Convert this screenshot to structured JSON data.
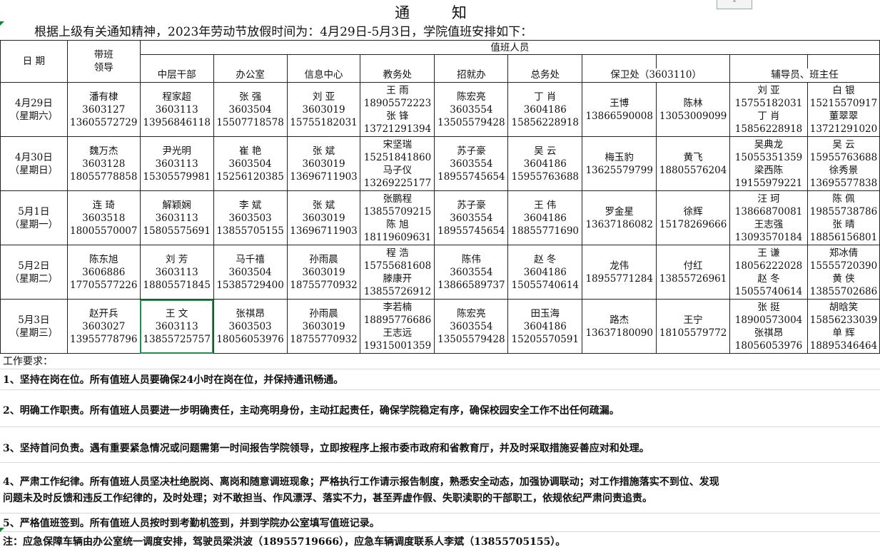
{
  "notice": {
    "title": "通 知",
    "intro": "根据上级有关通知精神，2023年劳动节放假时间为：4月29日-5月3日，学院值班安排如下：",
    "collapse_label": "⌃"
  },
  "table": {
    "headers": {
      "date": "日 期",
      "leader": [
        "带班",
        "领导"
      ],
      "duty_group": "值班人员",
      "cols": [
        "中层干部",
        "办公室",
        "信息中心",
        "教务处",
        "招就办",
        "总务处",
        "保卫处（3603110）",
        "辅导员、班主任"
      ]
    },
    "rows": [
      {
        "date": [
          "4月29日",
          "（星期六）"
        ],
        "cells": [
          [
            "潘有棣",
            "3603127",
            "13605572729"
          ],
          [
            "程家超",
            "3603113",
            "13956846118"
          ],
          [
            "张 强",
            "3603504",
            "15507718578"
          ],
          [
            "刘 亚",
            "3603019",
            "15755182031"
          ],
          [
            "王 雨",
            "18905572223",
            "张 锋",
            "13721291394"
          ],
          [
            "陈宏亮",
            "3603554",
            "13505579428"
          ],
          [
            "丁 肖",
            "3604186",
            "15856228918"
          ],
          [
            "王博",
            "13866590008"
          ],
          [
            "陈林",
            "13053009099"
          ],
          [
            "刘 亚",
            "15755182031",
            "丁 肖",
            "15856228918"
          ],
          [
            "白 银",
            "15215570917",
            "董翠翠",
            "13721291020"
          ]
        ]
      },
      {
        "date": [
          "4月30日",
          "（星期日）"
        ],
        "cells": [
          [
            "魏万杰",
            "3603128",
            "18055778858"
          ],
          [
            "尹光明",
            "3603113",
            "15305579981"
          ],
          [
            "崔 艳",
            "3603504",
            "15256120385"
          ],
          [
            "张 斌",
            "3603019",
            "13696711903"
          ],
          [
            "宋坚瑞",
            "15251841860",
            "马子仪",
            "13269225177"
          ],
          [
            "苏子豪",
            "3603554",
            "18955745654"
          ],
          [
            "吴 云",
            "3604186",
            "15955763688"
          ],
          [
            "梅玉豹",
            "13625579799"
          ],
          [
            "黄飞",
            "18805576204"
          ],
          [
            "吴典龙",
            "15055351359",
            "梁西陈",
            "19155979221"
          ],
          [
            "吴 云",
            "15955763688",
            "徐秀景",
            "13695577838"
          ]
        ]
      },
      {
        "date": [
          "5月1日",
          "（星期一）"
        ],
        "cells": [
          [
            "连 琦",
            "3603518",
            "18005570007"
          ],
          [
            "解颖娴",
            "3603113",
            "15805575691"
          ],
          [
            "李 斌",
            "3603503",
            "13855705155"
          ],
          [
            "张 斌",
            "3603019",
            "13696711903"
          ],
          [
            "张鹏程",
            "13855709215",
            "陈 旭",
            "18119609631"
          ],
          [
            "苏子豪",
            "3603554",
            "18955745654"
          ],
          [
            "王 伟",
            "3604186",
            "18855771690"
          ],
          [
            "罗金星",
            "13637186082"
          ],
          [
            "徐辉",
            "15178269666"
          ],
          [
            "汪 珂",
            "13866870081",
            "王志强",
            "13093570184"
          ],
          [
            "陈 佩",
            "19855738786",
            "张 晴",
            "18856156801"
          ]
        ]
      },
      {
        "date": [
          "5月2日",
          "（星期二）"
        ],
        "cells": [
          [
            "陈东旭",
            "3606886",
            "17705577226"
          ],
          [
            "刘 芳",
            "3603113",
            "18805571845"
          ],
          [
            "马千禧",
            "3603504",
            "15385729400"
          ],
          [
            "孙雨晨",
            "3603019",
            "18755770932"
          ],
          [
            "程 浩",
            "15755681608",
            "滕康开",
            "13855726912"
          ],
          [
            "陈伟",
            "3603554",
            "13866589737"
          ],
          [
            "赵 冬",
            "3604186",
            "15055740614"
          ],
          [
            "龙伟",
            "18955771284"
          ],
          [
            "付红",
            "13855726961"
          ],
          [
            "王 谦",
            "18056222028",
            "赵 冬",
            "15055740614"
          ],
          [
            "郑冰倩",
            "15555720390",
            "黄 侠",
            "13855702686"
          ]
        ]
      },
      {
        "date": [
          "5月3日",
          "（星期三）"
        ],
        "cells": [
          [
            "赵开兵",
            "3603027",
            "13955778796"
          ],
          [
            "王 文",
            "3603113",
            "13855725757"
          ],
          [
            "张祺昂",
            "3603503",
            "18056053976"
          ],
          [
            "孙雨晨",
            "3603019",
            "18755770932"
          ],
          [
            "李若楠",
            "18895776686",
            "王志远",
            "19315001359"
          ],
          [
            "陈宏亮",
            "3603554",
            "13505579428"
          ],
          [
            "田玉海",
            "3604186",
            "15205570591"
          ],
          [
            "路杰",
            "13637180090"
          ],
          [
            "王宁",
            "18105579772"
          ],
          [
            "张 挺",
            "18900573004",
            "张祺昂",
            "18056053976"
          ],
          [
            "胡晗笑",
            "15856233039",
            "单 辉",
            "18895346464"
          ]
        ]
      }
    ]
  },
  "requirements": {
    "heading": "工作要求：",
    "items": [
      "1、坚持在岗在位。所有值班人员要确保24小时在岗在位，并保持通讯畅通。",
      "2、明确工作职责。所有值班人员要进一步明确责任，主动亮明身份，主动扛起责任，确保学院稳定有序，确保校园安全工作不出任何疏漏。",
      "3、坚持首问负责。遇有重要紧急情况或问题需第一时间报告学院领导，立即按程序上报市委市政府和省教育厅，并及时采取措施妥善应对和处理。",
      "4、严肃工作纪律。所有值班人员坚决杜绝脱岗、离岗和随意调班现象；严格执行工作请示报告制度，熟悉安全动态，加强协调联动；对工作措施落实不到位、发现",
      "问题未及时反馈和违反工作纪律的，及时处理；对不敢担当、作风漂浮、落实不力，甚至弄虚作假、失职渎职的干部职工，依规依纪严肃问责追责。",
      "5、严格值班签到。所有值班人员按时到考勤机签到，并到学院办公室填写值班记录。"
    ],
    "note": "注：应急保障车辆由办公室统一调度安排，驾驶员梁洪波（18955719666），应急车辆调度联系人李斌（13855705155）。"
  }
}
